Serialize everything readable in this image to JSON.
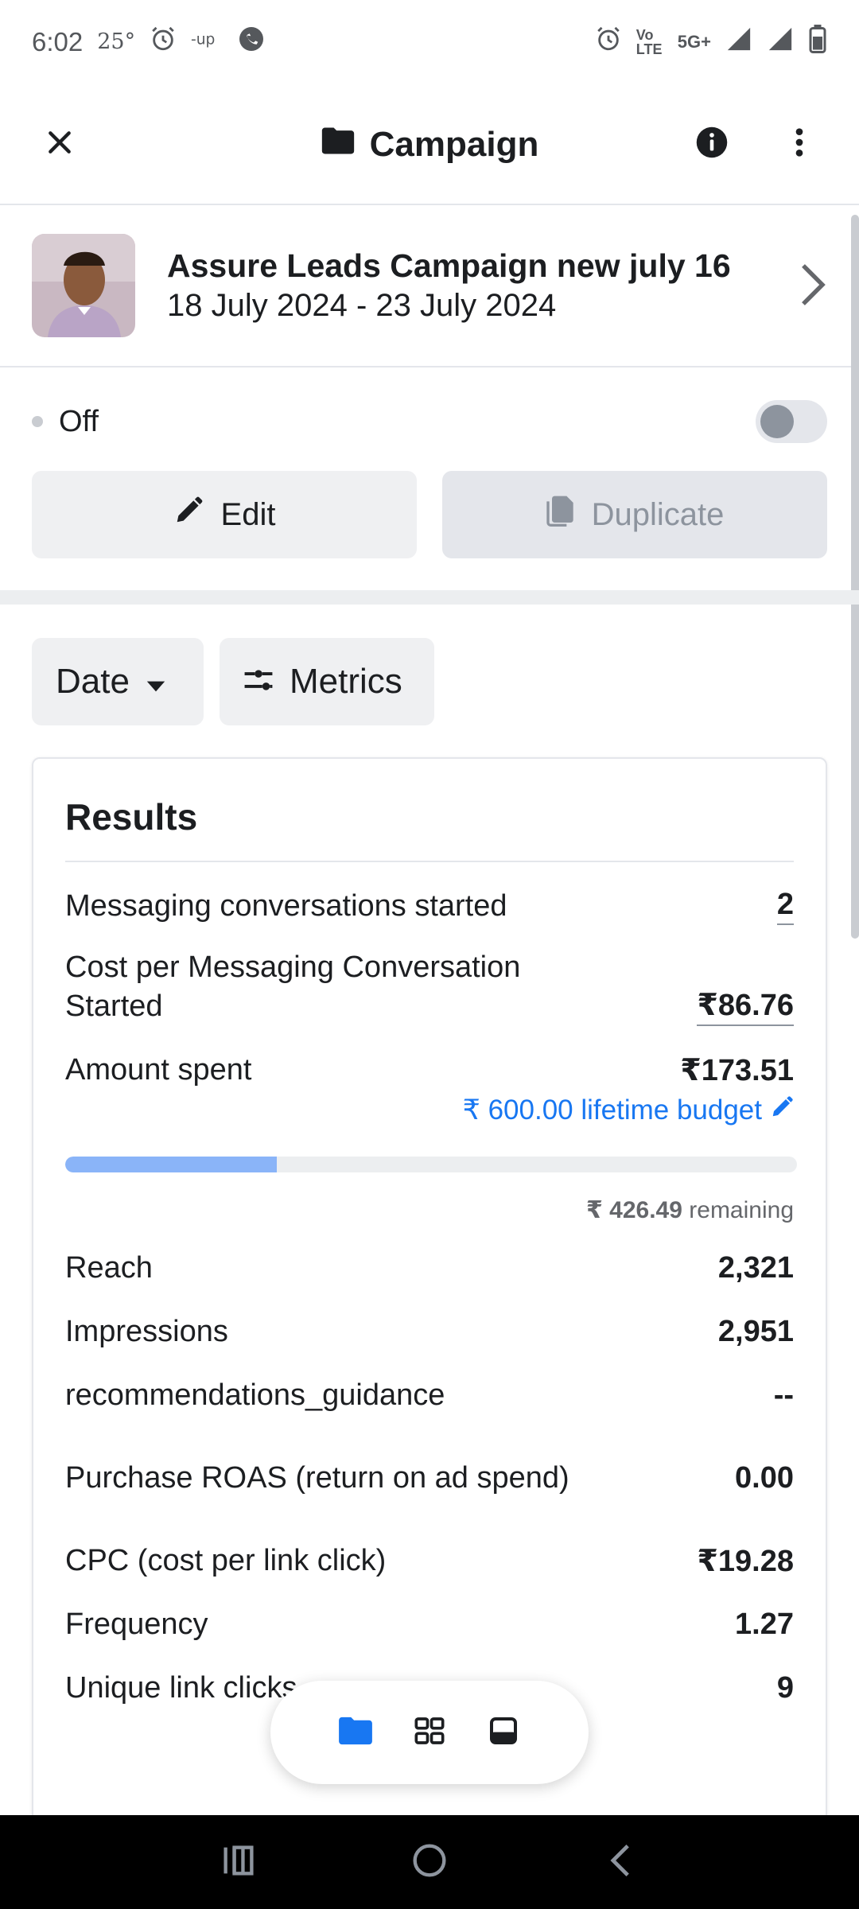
{
  "status_bar": {
    "time": "6:02",
    "temperature": "25°",
    "network_small_1": "Vo LTE",
    "network_small_2": "5G+"
  },
  "header": {
    "title": "Campaign",
    "close_icon": "close-icon",
    "folder_icon": "folder-icon",
    "info_icon": "info-icon",
    "more_icon": "more-vertical-icon"
  },
  "campaign": {
    "name": "Assure Leads Campaign new july 16",
    "dates": "18 July 2024 - 23 July 2024"
  },
  "status": {
    "label": "Off",
    "toggle_on": false
  },
  "actions": {
    "edit_label": "Edit",
    "duplicate_label": "Duplicate"
  },
  "filters": {
    "date_label": "Date",
    "metrics_label": "Metrics"
  },
  "results": {
    "title": "Results",
    "budget_text": "₹ 600.00 lifetime budget",
    "budget_progress_fraction": 0.289,
    "remaining_amount": "₹ 426.49",
    "remaining_label": "remaining",
    "rows": [
      {
        "label": "Messaging conversations started",
        "value": "2"
      },
      {
        "label": "Cost per Messaging Conversation Started",
        "value": "₹86.76"
      },
      {
        "label": "Amount spent",
        "value": "₹173.51"
      },
      {
        "label": "Reach",
        "value": "2,321"
      },
      {
        "label": "Impressions",
        "value": "2,951"
      },
      {
        "label": "recommendations_guidance",
        "value": "--"
      },
      {
        "label": "Purchase ROAS (return on ad spend)",
        "value": "0.00"
      },
      {
        "label": "CPC (cost per link click)",
        "value": "₹19.28"
      },
      {
        "label": "Frequency",
        "value": "1.27"
      },
      {
        "label": "Unique link clicks",
        "value": "9"
      }
    ]
  },
  "colors": {
    "accent": "#1877f2",
    "progress_fill": "#8ab4f8"
  },
  "bottom_nav": {
    "items": [
      "folder-icon",
      "grid-icon",
      "ad-preview-icon"
    ]
  }
}
